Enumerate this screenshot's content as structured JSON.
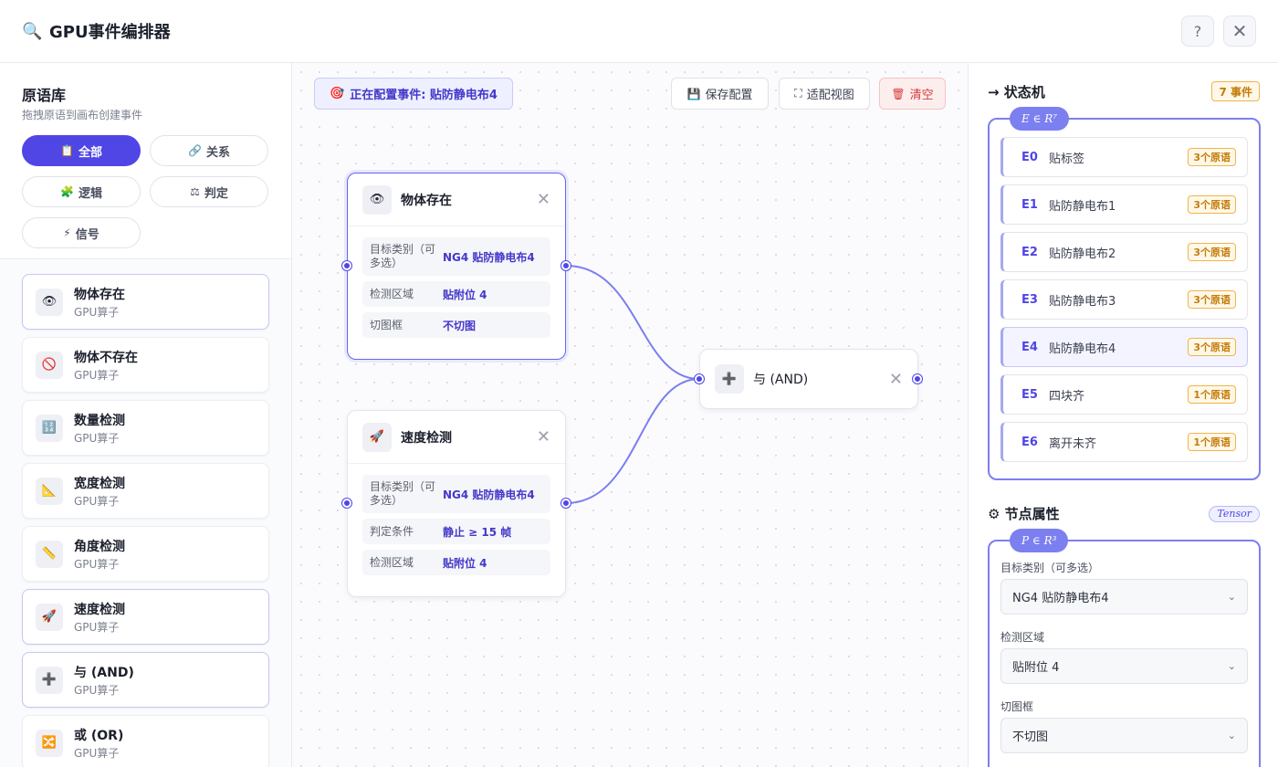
{
  "header": {
    "title_icon": "🔍",
    "title": "GPU事件编排器",
    "help_label": "?",
    "close_label": "✕"
  },
  "library": {
    "title": "原语库",
    "subtitle": "拖拽原语到画布创建事件",
    "filters": [
      {
        "icon": "📋",
        "label": "全部",
        "active": true
      },
      {
        "icon": "🔗",
        "label": "关系"
      },
      {
        "icon": "🧩",
        "label": "逻辑"
      },
      {
        "icon": "⚖",
        "label": "判定"
      },
      {
        "icon": "⚡",
        "label": "信号"
      }
    ],
    "items": [
      {
        "icon": "👁",
        "name": "物体存在",
        "sub": "GPU算子"
      },
      {
        "icon": "🚫",
        "name": "物体不存在",
        "sub": "GPU算子"
      },
      {
        "icon": "🔢",
        "name": "数量检测",
        "sub": "GPU算子"
      },
      {
        "icon": "📐",
        "name": "宽度检测",
        "sub": "GPU算子"
      },
      {
        "icon": "📏",
        "name": "角度检测",
        "sub": "GPU算子"
      },
      {
        "icon": "🚀",
        "name": "速度检测",
        "sub": "GPU算子"
      },
      {
        "icon": "➕",
        "name": "与 (AND)",
        "sub": "GPU算子"
      },
      {
        "icon": "🔀",
        "name": "或 (OR)",
        "sub": "GPU算子"
      }
    ]
  },
  "canvas": {
    "config_icon": "🎯",
    "config_label": "正在配置事件: 贴防静电布4",
    "save": {
      "icon": "💾",
      "label": "保存配置"
    },
    "fit": {
      "icon": "⛶",
      "label": "适配视图"
    },
    "clear": {
      "icon": "🗑",
      "label": "清空"
    },
    "nodes": {
      "exist": {
        "icon": "👁",
        "title": "物体存在",
        "close": "✕",
        "rows": [
          {
            "key": "目标类别（可多选）",
            "value": "NG4 贴防静电布4"
          },
          {
            "key": "检测区域",
            "value": "贴附位 4"
          },
          {
            "key": "切图框",
            "value": "不切图"
          }
        ]
      },
      "speed": {
        "icon": "🚀",
        "title": "速度检测",
        "close": "✕",
        "rows": [
          {
            "key": "目标类别（可多选）",
            "value": "NG4 贴防静电布4"
          },
          {
            "key": "判定条件",
            "value": "静止 ≥ 15 帧"
          },
          {
            "key": "检测区域",
            "value": "贴附位 4"
          }
        ]
      },
      "and": {
        "icon": "➕",
        "title": "与 (AND)",
        "close": "✕"
      }
    }
  },
  "state_machine": {
    "title": "→ 状态机",
    "count_badge": "7 事件",
    "math_label": "E ∈ R⁷",
    "events": [
      {
        "id": "E0",
        "name": "贴标签",
        "count": "3个原语"
      },
      {
        "id": "E1",
        "name": "贴防静电布1",
        "count": "3个原语"
      },
      {
        "id": "E2",
        "name": "贴防静电布2",
        "count": "3个原语"
      },
      {
        "id": "E3",
        "name": "贴防静电布3",
        "count": "3个原语"
      },
      {
        "id": "E4",
        "name": "贴防静电布4",
        "count": "3个原语",
        "active": true
      },
      {
        "id": "E5",
        "name": "四块齐",
        "count": "1个原语"
      },
      {
        "id": "E6",
        "name": "离开未齐",
        "count": "1个原语"
      }
    ]
  },
  "node_props": {
    "title": "⚙ 节点属性",
    "tensor_badge": "Tensor",
    "math_label": "P ∈ R³",
    "fields": [
      {
        "label": "目标类别（可多选）",
        "value": "NG4 贴防静电布4"
      },
      {
        "label": "检测区域",
        "value": "贴附位 4"
      },
      {
        "label": "切图框",
        "value": "不切图"
      }
    ],
    "chevron": "⌄"
  },
  "colors": {
    "accent": "#4f46e5",
    "wire": "#7b7ef0",
    "badge_orange": "#c47b07",
    "danger": "#d33b3b"
  }
}
